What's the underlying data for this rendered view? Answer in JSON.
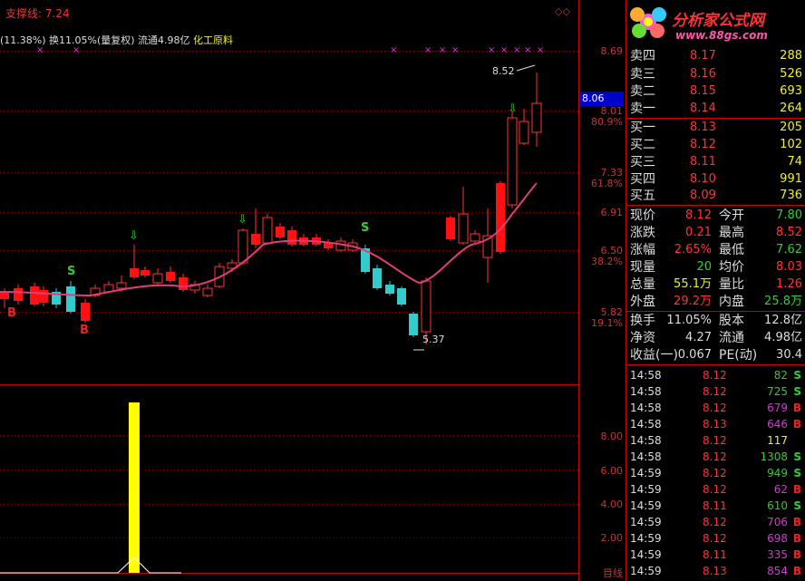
{
  "header": {
    "support_line": "支撑线: 7.24",
    "info_prefix": "(11.38%) 换11.05%(量复权) 流通4.98亿",
    "sector": "化工原料",
    "corner_icons": "◇◇"
  },
  "price_axis": [
    "8.69",
    "8.01",
    "80.9%",
    "7.33",
    "61.8%",
    "6.91",
    "6.50",
    "38.2%",
    "5.82",
    "19.1%"
  ],
  "current_price_box": "8.06",
  "volume_axis": [
    "8.00",
    "6.00",
    "4.00",
    "2.00"
  ],
  "volume_bottom_label": "目线",
  "chart_labels": {
    "high_price": "8.52",
    "low_price": "5.37",
    "markers": [
      {
        "text": "S",
        "color": "#3c3"
      },
      {
        "text": "B",
        "color": "#e22"
      },
      {
        "text": "B",
        "color": "#e22"
      },
      {
        "text": "S",
        "color": "#3c3"
      }
    ]
  },
  "logo": {
    "title": "分析家公式网",
    "url": "www.88gs.com"
  },
  "order_book": {
    "asks": [
      {
        "label": "卖四",
        "price": "8.17",
        "volume": "288"
      },
      {
        "label": "卖三",
        "price": "8.16",
        "volume": "526"
      },
      {
        "label": "卖二",
        "price": "8.15",
        "volume": "693"
      },
      {
        "label": "卖一",
        "price": "8.14",
        "volume": "264"
      }
    ],
    "bids": [
      {
        "label": "买一",
        "price": "8.13",
        "volume": "205"
      },
      {
        "label": "买二",
        "price": "8.12",
        "volume": "102"
      },
      {
        "label": "买三",
        "price": "8.11",
        "volume": "74"
      },
      {
        "label": "买四",
        "price": "8.10",
        "volume": "991"
      },
      {
        "label": "买五",
        "price": "8.09",
        "volume": "736"
      }
    ]
  },
  "stats": [
    {
      "l1": "现价",
      "v1": "8.12",
      "c1": "red",
      "l2": "今开",
      "v2": "7.80",
      "c2": "green"
    },
    {
      "l1": "涨跌",
      "v1": "0.21",
      "c1": "red",
      "l2": "最高",
      "v2": "8.52",
      "c2": "red"
    },
    {
      "l1": "涨幅",
      "v1": "2.65%",
      "c1": "red",
      "l2": "最低",
      "v2": "7.62",
      "c2": "green"
    },
    {
      "l1": "现量",
      "v1": "20",
      "c1": "green",
      "l2": "均价",
      "v2": "8.03",
      "c2": "red"
    },
    {
      "l1": "总量",
      "v1": "55.1万",
      "c1": "yellow",
      "l2": "量比",
      "v2": "1.26",
      "c2": "red"
    },
    {
      "l1": "外盘",
      "v1": "29.2万",
      "c1": "red",
      "l2": "内盘",
      "v2": "25.8万",
      "c2": "green"
    }
  ],
  "stats2": [
    {
      "l1": "换手",
      "v1": "11.05%",
      "c1": "white",
      "l2": "股本",
      "v2": "12.8亿",
      "c2": "white"
    },
    {
      "l1": "净资",
      "v1": "4.27",
      "c1": "white",
      "l2": "流通",
      "v2": "4.98亿",
      "c2": "white"
    },
    {
      "l1": "收益(一)",
      "v1": "0.067",
      "c1": "white",
      "l2": "PE(动)",
      "v2": "30.4",
      "c2": "white"
    }
  ],
  "ticks": [
    {
      "time": "14:58",
      "price": "8.12",
      "vol": "82",
      "side": "S"
    },
    {
      "time": "14:58",
      "price": "8.12",
      "vol": "725",
      "side": "S"
    },
    {
      "time": "14:58",
      "price": "8.12",
      "vol": "679",
      "side": "B"
    },
    {
      "time": "14:58",
      "price": "8.13",
      "vol": "646",
      "side": "B"
    },
    {
      "time": "14:58",
      "price": "8.12",
      "vol": "117",
      "side": ""
    },
    {
      "time": "14:58",
      "price": "8.12",
      "vol": "1308",
      "side": "S"
    },
    {
      "time": "14:59",
      "price": "8.12",
      "vol": "949",
      "side": "S"
    },
    {
      "time": "14:59",
      "price": "8.12",
      "vol": "62",
      "side": "B"
    },
    {
      "time": "14:59",
      "price": "8.11",
      "vol": "610",
      "side": "S"
    },
    {
      "time": "14:59",
      "price": "8.12",
      "vol": "706",
      "side": "B"
    },
    {
      "time": "14:59",
      "price": "8.12",
      "vol": "698",
      "side": "B"
    },
    {
      "time": "14:59",
      "price": "8.11",
      "vol": "335",
      "side": "B"
    },
    {
      "time": "14:59",
      "price": "8.13",
      "vol": "854",
      "side": "B"
    }
  ]
}
